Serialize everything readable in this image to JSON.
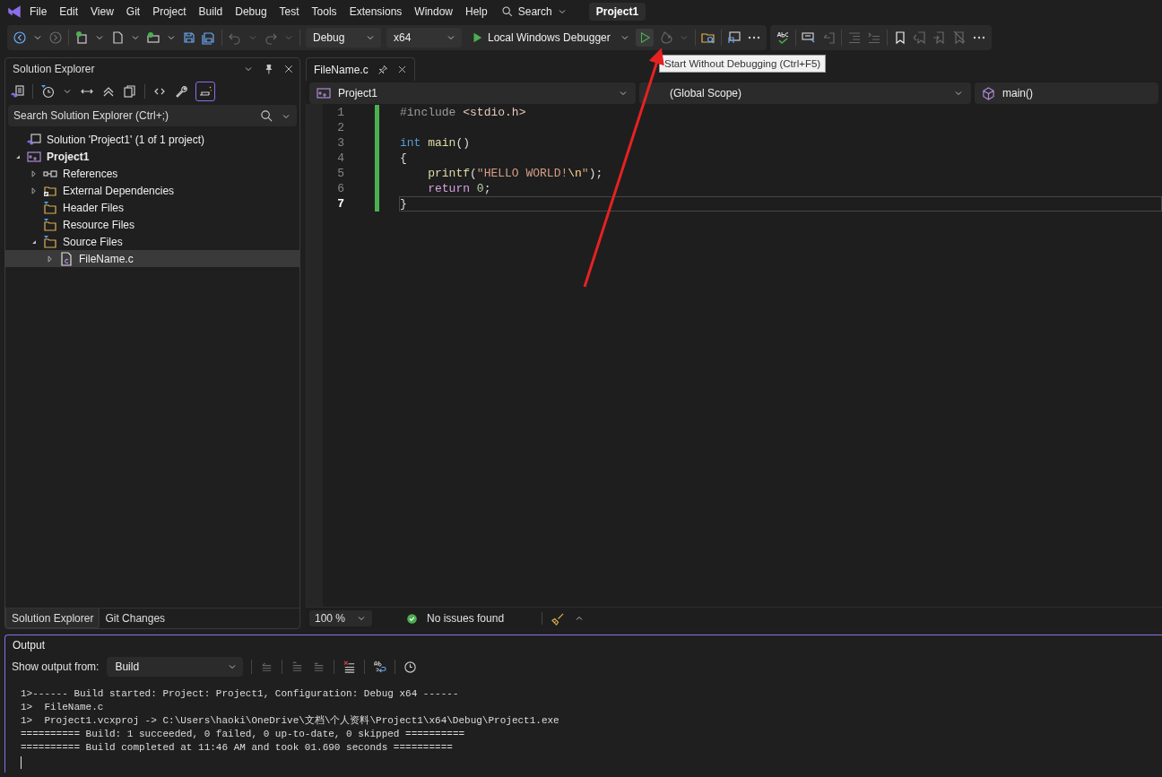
{
  "menu": {
    "items": [
      "File",
      "Edit",
      "View",
      "Git",
      "Project",
      "Build",
      "Debug",
      "Test",
      "Tools",
      "Extensions",
      "Window",
      "Help"
    ],
    "search": "Search",
    "solution_name": "Project1"
  },
  "toolbar": {
    "configuration": "Debug",
    "platform": "x64",
    "debugger": "Local Windows Debugger"
  },
  "tooltip": "Start Without Debugging (Ctrl+F5)",
  "solution_explorer": {
    "title": "Solution Explorer",
    "search_placeholder": "Search Solution Explorer (Ctrl+;)",
    "tree": [
      {
        "label": "Solution 'Project1' (1 of 1 project)",
        "kind": "solution",
        "selected": false,
        "children": [
          {
            "label": "Project1",
            "kind": "project",
            "expanded": true,
            "selected": false,
            "children": [
              {
                "label": "References",
                "kind": "references",
                "expanded": false,
                "selected": false
              },
              {
                "label": "External Dependencies",
                "kind": "external",
                "expanded": false,
                "selected": false
              },
              {
                "label": "Header Files",
                "kind": "filter",
                "selected": false
              },
              {
                "label": "Resource Files",
                "kind": "filter",
                "selected": false
              },
              {
                "label": "Source Files",
                "kind": "filter",
                "expanded": true,
                "selected": false,
                "children": [
                  {
                    "label": "FileName.c",
                    "kind": "file",
                    "expanded": false,
                    "selected": true
                  }
                ]
              }
            ]
          }
        ]
      }
    ],
    "bottom_tabs": [
      {
        "label": "Solution Explorer",
        "selected": true
      },
      {
        "label": "Git Changes",
        "selected": false
      }
    ]
  },
  "editor": {
    "tabs": [
      {
        "label": "FileName.c",
        "selected": true
      }
    ],
    "nav": {
      "project": "Project1",
      "scope": "(Global Scope)",
      "member": "main()"
    },
    "lines": [
      {
        "number": "1",
        "current": false,
        "changed": true,
        "tokens": [
          {
            "text": "#include",
            "kind": "preproc"
          },
          {
            "text": " <stdio.h>",
            "kind": "include"
          }
        ]
      },
      {
        "number": "2",
        "current": false,
        "changed": true
      },
      {
        "number": "3",
        "current": false,
        "changed": true,
        "tokens": [
          {
            "text": "int",
            "kind": "keyword"
          },
          {
            "text": " main",
            "kind": "function"
          },
          {
            "text": "()",
            "kind": "plain"
          }
        ]
      },
      {
        "number": "4",
        "current": false,
        "changed": true,
        "tokens": [
          {
            "text": "{",
            "kind": "plain"
          }
        ]
      },
      {
        "number": "5",
        "current": false,
        "changed": true,
        "indent": true,
        "tokens": [
          {
            "text": "printf",
            "kind": "function"
          },
          {
            "text": "(",
            "kind": "plain"
          },
          {
            "text": "\"HELLO WORLD!",
            "kind": "string"
          },
          {
            "text": "\\n",
            "kind": "escape"
          },
          {
            "text": "\"",
            "kind": "string"
          },
          {
            "text": ");",
            "kind": "plain"
          }
        ]
      },
      {
        "number": "6",
        "current": false,
        "changed": true,
        "indent": true,
        "tokens": [
          {
            "text": "return",
            "kind": "control"
          },
          {
            "text": " 0",
            "kind": "number"
          },
          {
            "text": ";",
            "kind": "plain"
          }
        ]
      },
      {
        "number": "7",
        "current": true,
        "changed": true,
        "tokens": [
          {
            "text": "}",
            "kind": "plain"
          }
        ]
      }
    ],
    "status": {
      "zoom": "100 %",
      "issues": "No issues found"
    }
  },
  "output": {
    "title": "Output",
    "source_label": "Show output from:",
    "source": "Build",
    "lines": [
      "1>------ Build started: Project: Project1, Configuration: Debug x64 ------",
      "1>  FileName.c",
      "1>  Project1.vcxproj -> C:\\Users\\haoki\\OneDrive\\文档\\个人资料\\Project1\\x64\\Debug\\Project1.exe",
      "========== Build: 1 succeeded, 0 failed, 0 up-to-date, 0 skipped ==========",
      "========== Build completed at 11:46 AM and took 01.690 seconds =========="
    ]
  }
}
